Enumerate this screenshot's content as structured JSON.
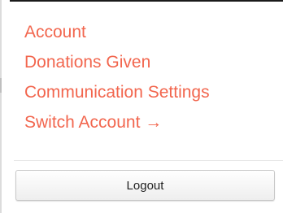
{
  "menu": {
    "items": [
      {
        "label": "Account"
      },
      {
        "label": "Donations Given"
      },
      {
        "label": "Communication Settings"
      },
      {
        "label": "Switch Account →"
      }
    ]
  },
  "logout": {
    "label": "Logout"
  },
  "colors": {
    "link": "#f2664e",
    "button_text": "#222222",
    "button_border": "#c8c8c8"
  }
}
